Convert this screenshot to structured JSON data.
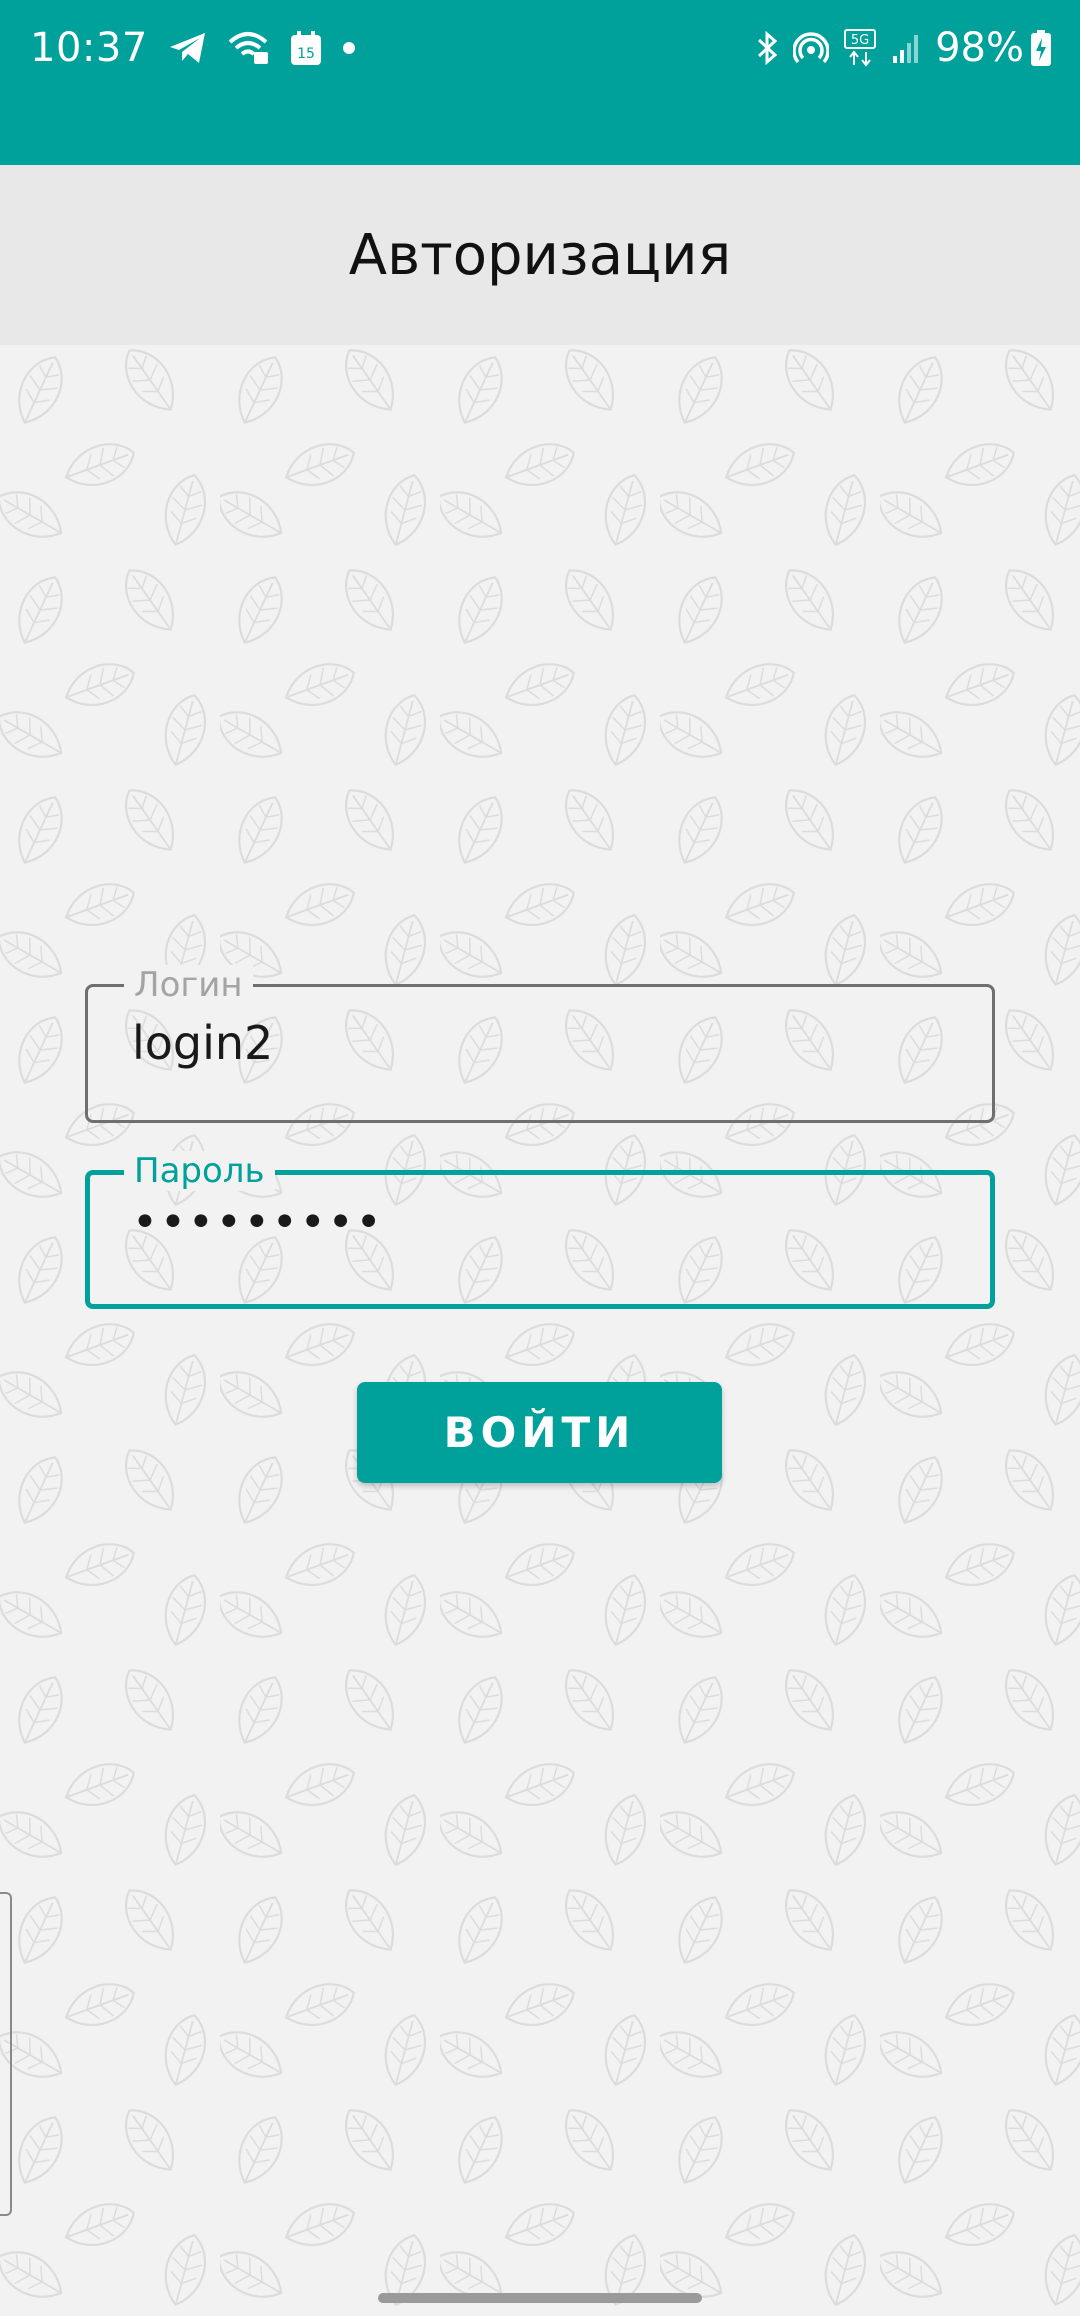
{
  "status_bar": {
    "time": "10:37",
    "calendar_day": "15",
    "network_type": "5G",
    "battery": "98%",
    "left_icons": [
      "telegram-icon",
      "wifi-calling-icon",
      "calendar-icon",
      "notification-dot-icon"
    ],
    "right_icons": [
      "bluetooth-icon",
      "hotspot-icon",
      "5g-data-icon",
      "signal-icon",
      "battery-charging-icon"
    ],
    "background_color": "#00a09b"
  },
  "app_bar": {
    "title": "Авторизация"
  },
  "form": {
    "login": {
      "label": "Логин",
      "value": "login2"
    },
    "password": {
      "label": "Пароль",
      "value": "•••••••••"
    },
    "submit_label": "ВОЙТИ"
  },
  "colors": {
    "accent": "#00a09b",
    "background": "#f2f2f2",
    "app_bar_background": "#e8e8e8"
  }
}
